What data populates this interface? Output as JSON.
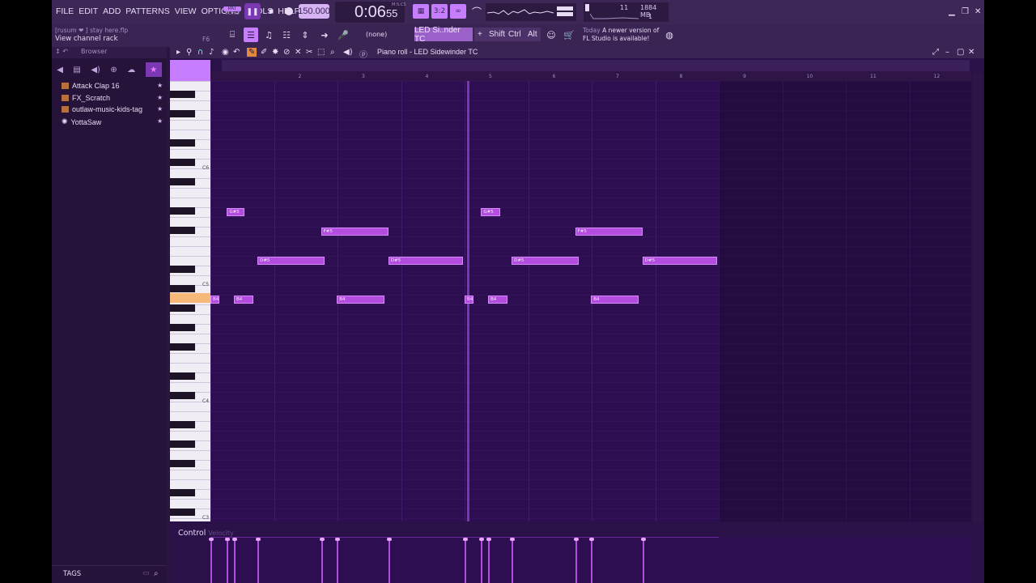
{
  "menu": [
    "FILE",
    "EDIT",
    "ADD",
    "PATTERNS",
    "VIEW",
    "OPTIONS",
    "TOOLS",
    "HELP"
  ],
  "transport": {
    "pat": "PAT",
    "song": "SONG",
    "tempo": "150.000",
    "time": "0:06",
    "time_sub": "55",
    "time_label": "M:S:CS"
  },
  "cpu": {
    "voices": "11",
    "memory": "1884 MB",
    "cores": "1"
  },
  "hint": {
    "top": "[rusum ❤   ] stay here.flp",
    "bottom": "View channel rack",
    "shortcut": "F6"
  },
  "toolbar": {
    "pattern": "(none)",
    "channel": "LED Si..nder TC",
    "shift": "Shift",
    "ctrl": "Ctrl",
    "alt": "Alt"
  },
  "news": {
    "line1": "Today",
    "line2": "A newer version of",
    "line3": "FL Studio is available!"
  },
  "browser": {
    "title": "Browser",
    "items": [
      {
        "label": "Attack Clap 16"
      },
      {
        "label": "FX_Scratch"
      },
      {
        "label": "outlaw-music-kids-tag"
      },
      {
        "label": "YottaSaw"
      }
    ],
    "tags": "TAGS"
  },
  "piano_roll": {
    "title": "Piano roll - LED Sidewinder TC",
    "bars": [
      "2",
      "3",
      "4",
      "5",
      "6",
      "7",
      "8",
      "9",
      "10",
      "11",
      "12"
    ],
    "octaves": [
      "C6",
      "C5",
      "C4",
      "C3"
    ],
    "control": "Control",
    "velocity_label": "Velocity"
  },
  "notes": [
    {
      "label": "G#5",
      "start": 1.26,
      "len": 0.28,
      "row": "gs5"
    },
    {
      "label": "F#5",
      "start": 2.74,
      "len": 1.06,
      "row": "fs5"
    },
    {
      "label": "D#5",
      "start": 1.74,
      "len": 1.06,
      "row": "ds5"
    },
    {
      "label": "D#5",
      "start": 3.8,
      "len": 1.18,
      "row": "ds5"
    },
    {
      "label": "B4",
      "start": 1.0,
      "len": 0.14,
      "row": "b4"
    },
    {
      "label": "B4",
      "start": 1.37,
      "len": 0.31,
      "row": "b4"
    },
    {
      "label": "B4",
      "start": 2.99,
      "len": 0.75,
      "row": "b4"
    },
    {
      "label": "B4",
      "start": 5.0,
      "len": 0.14,
      "row": "b4"
    },
    {
      "label": "G#5",
      "start": 5.26,
      "len": 0.3,
      "row": "gs5"
    },
    {
      "label": "B4",
      "start": 5.37,
      "len": 0.31,
      "row": "b4"
    },
    {
      "label": "D#5",
      "start": 5.74,
      "len": 1.06,
      "row": "ds5"
    },
    {
      "label": "F#5",
      "start": 6.74,
      "len": 1.06,
      "row": "fs5"
    },
    {
      "label": "B4",
      "start": 6.99,
      "len": 0.75,
      "row": "b4"
    },
    {
      "label": "D#5",
      "start": 7.8,
      "len": 1.18,
      "row": "ds5"
    }
  ],
  "colors": {
    "accent": "#c77dff",
    "note": "#b34de0",
    "bg": "#2a1148"
  }
}
